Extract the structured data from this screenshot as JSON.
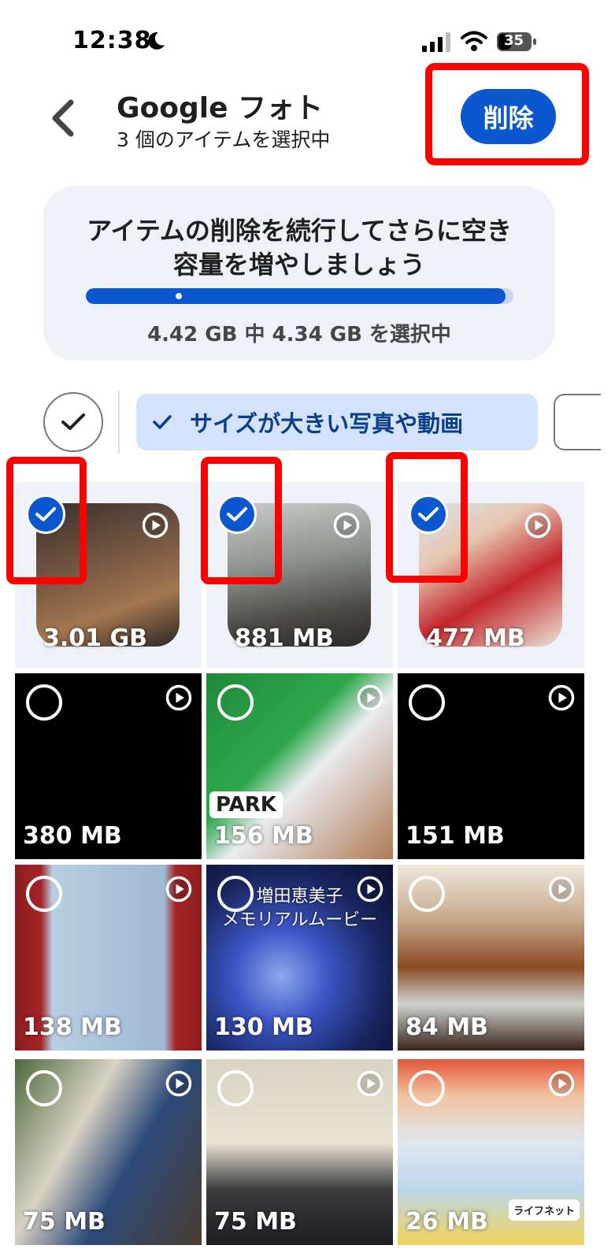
{
  "status_bar": {
    "time": "12:38",
    "battery": "35"
  },
  "header": {
    "title": "Google フォト",
    "subtitle": "3 個のアイテムを選択中",
    "delete_label": "削除"
  },
  "storage_card": {
    "message": "アイテムの削除を続行してさらに空き容量を増やしましょう",
    "usage": "4.42 GB 中 4.34 GB を選択中",
    "progress_fraction": 0.982
  },
  "filter": {
    "chip_label": "サイズが大きい写真や動画",
    "chip_selected": true
  },
  "colors": {
    "accent": "#0b57d0",
    "annotation": "#ff0000",
    "chip_bg": "#d3e3fd"
  },
  "grid": {
    "items": [
      {
        "size": "3.01 GB",
        "selected": true,
        "type": "video"
      },
      {
        "size": "881 MB",
        "selected": true,
        "type": "video"
      },
      {
        "size": "477 MB",
        "selected": true,
        "type": "video"
      },
      {
        "size": "380 MB",
        "selected": false,
        "type": "video"
      },
      {
        "size": "156 MB",
        "selected": false,
        "type": "video",
        "overlay": "PARK"
      },
      {
        "size": "151 MB",
        "selected": false,
        "type": "video"
      },
      {
        "size": "138 MB",
        "selected": false,
        "type": "video"
      },
      {
        "size": "130 MB",
        "selected": false,
        "type": "video",
        "overlay_line1": "増田恵美子",
        "overlay_line2": "メモリアルムービー"
      },
      {
        "size": "84 MB",
        "selected": false,
        "type": "video"
      },
      {
        "size": "75 MB",
        "selected": false,
        "type": "video"
      },
      {
        "size": "75 MB",
        "selected": false,
        "type": "video"
      },
      {
        "size": "26 MB",
        "selected": false,
        "type": "video",
        "overlay": "ライフネット"
      }
    ]
  }
}
